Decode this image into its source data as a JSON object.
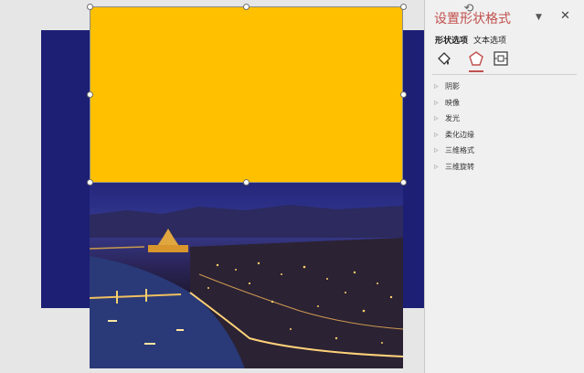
{
  "pane": {
    "title": "设置形状格式",
    "tabs": [
      {
        "label": "形状选项",
        "active": true
      },
      {
        "label": "文本选项",
        "active": false
      }
    ],
    "icons": [
      "fill-line-icon",
      "effects-icon",
      "size-properties-icon"
    ],
    "active_icon": "effects-icon",
    "sections": [
      {
        "label": "阴影"
      },
      {
        "label": "映像"
      },
      {
        "label": "发光"
      },
      {
        "label": "柔化边缘"
      },
      {
        "label": "三维格式"
      },
      {
        "label": "三维旋转"
      }
    ]
  },
  "slide": {
    "background_color": "#1c1f74",
    "shape_fill_color": "#ffc000",
    "accent_color": "#c0504d"
  }
}
